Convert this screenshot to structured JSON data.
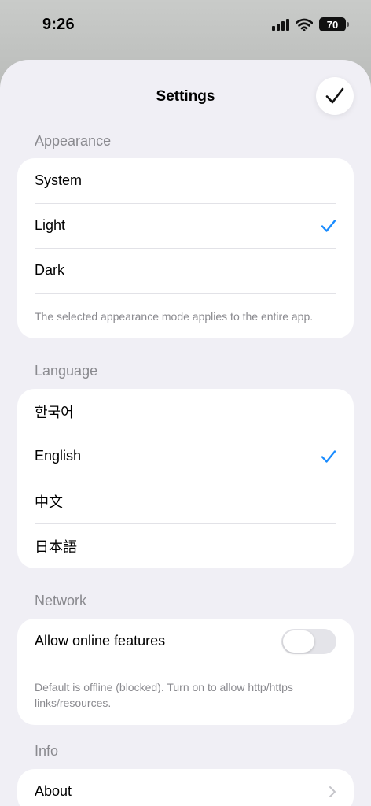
{
  "status_bar": {
    "time": "9:26",
    "battery": "70"
  },
  "header": {
    "title": "Settings",
    "done_icon": "checkmark-icon"
  },
  "appearance": {
    "header": "Appearance",
    "options": [
      "System",
      "Light",
      "Dark"
    ],
    "selected": "Light",
    "footnote": "The selected appearance mode applies to the entire app."
  },
  "language": {
    "header": "Language",
    "options": [
      "한국어",
      "English",
      "中文",
      "日本語"
    ],
    "selected": "English"
  },
  "network": {
    "header": "Network",
    "allow_online_label": "Allow online features",
    "allow_online_enabled": false,
    "footnote": "Default is offline (blocked). Turn on to allow http/https links/resources."
  },
  "info": {
    "header": "Info",
    "about_label": "About"
  },
  "colors": {
    "accent": "#1a8cff",
    "secondary_text": "#8a8a8f",
    "background": "#f0eff5"
  }
}
